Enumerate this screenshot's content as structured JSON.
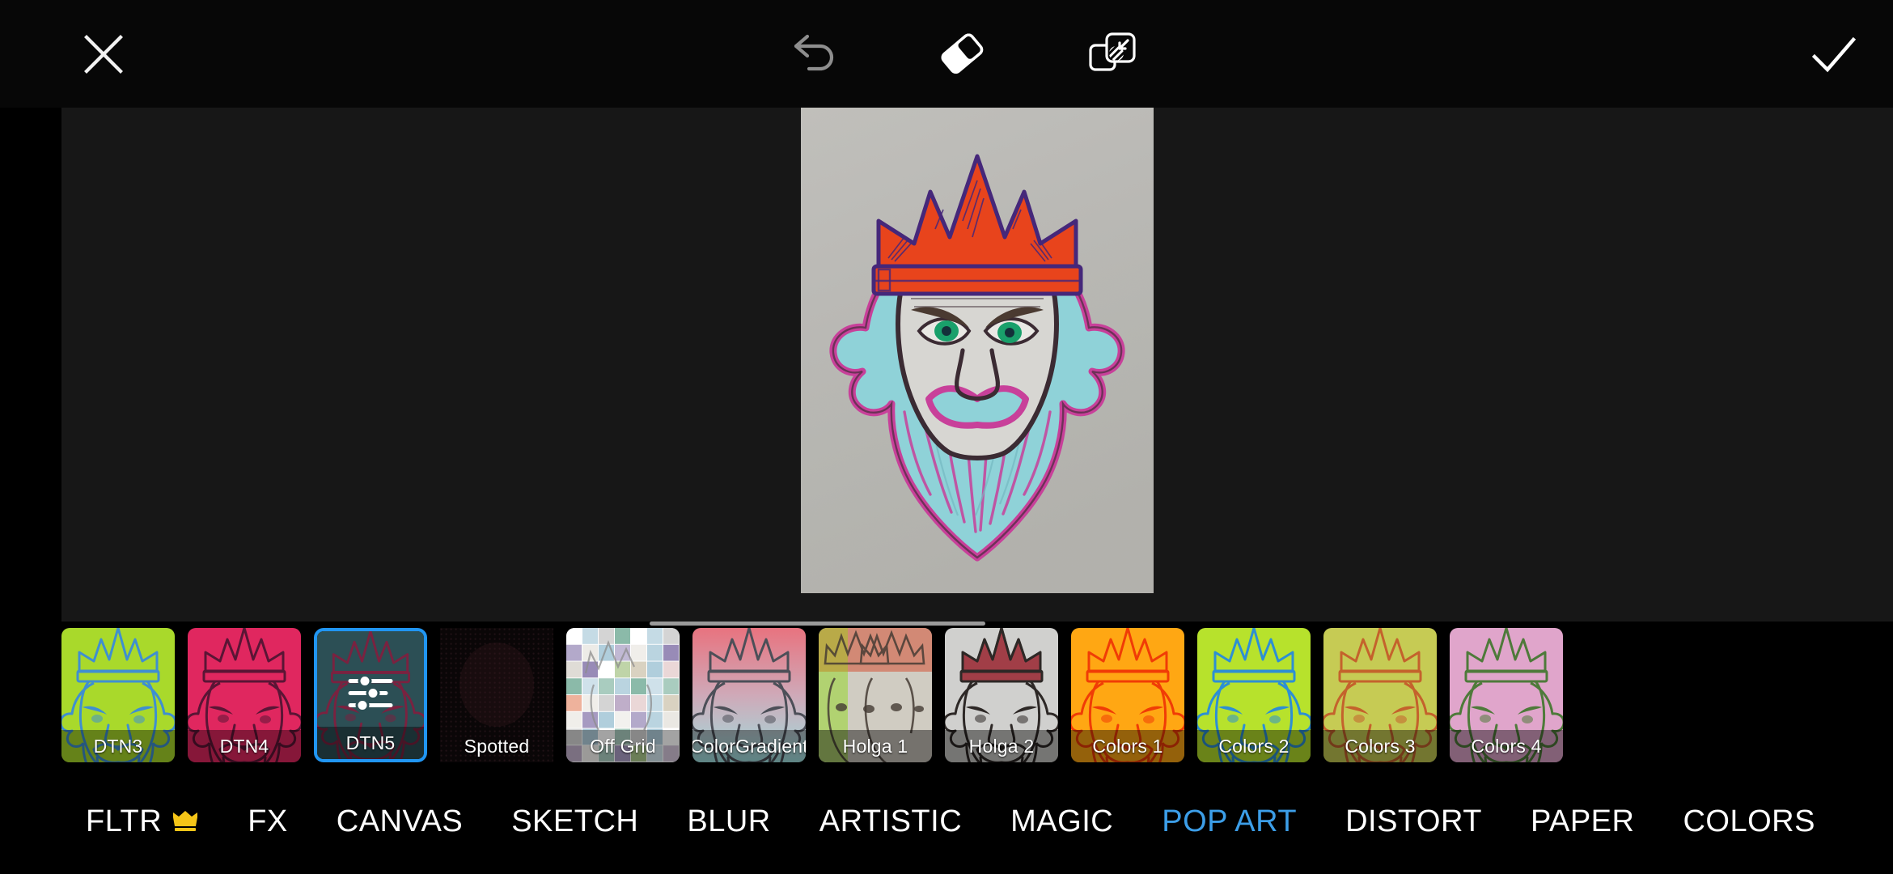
{
  "toolbar": {
    "close_label": "Close",
    "close_icon": "close-x-icon",
    "undo_label": "Undo",
    "undo_icon": "undo-arrow-icon",
    "eraser_label": "Eraser",
    "eraser_icon": "eraser-icon",
    "layers_label": "Compare",
    "layers_icon": "compare-layers-icon",
    "done_label": "Apply",
    "done_icon": "checkmark-icon"
  },
  "canvas": {
    "artwork_title": "King with crown drawing",
    "paper_color": "#bdbcb8",
    "crown_color": "#e8441c",
    "hair_color": "#8fd2d8",
    "hair_outline_color": "#c8409a",
    "ink_color": "#3b2b33",
    "eye_color": "#19a06b"
  },
  "filter_strip": {
    "selected": "DTN5",
    "selected_border_color": "#2196f3",
    "items": [
      {
        "label": "DTN3",
        "bg": "#a9d92b",
        "ink": "#3f8fd0",
        "band": "rgba(0,0,0,.40)",
        "style": "king",
        "icon": null
      },
      {
        "label": "DTN4",
        "bg": "#e0275f",
        "ink": "#5a1535",
        "band": "rgba(0,0,0,.40)",
        "style": "king",
        "icon": null
      },
      {
        "label": "DTN5",
        "bg": "#2c4f55",
        "ink": "#7a2240",
        "band": "rgba(0,0,0,.40)",
        "style": "king",
        "icon": "sliders-icon"
      },
      {
        "label": "Spotted",
        "bg": "#0a0607",
        "ink": "#241318",
        "band": "transparent",
        "style": "dots",
        "icon": null
      },
      {
        "label": "Off Grid",
        "bg": "#ffffff",
        "ink": "#8c8c8c",
        "band": "rgba(0,0,0,.36)",
        "style": "grid",
        "icon": null
      },
      {
        "label": "ColorGradient",
        "bg": "#e88a9a",
        "ink": "#4c4f58",
        "band": "rgba(0,0,0,.40)",
        "style": "gradient",
        "icon": null
      },
      {
        "label": "Holga 1",
        "bg": "#c9cfc0",
        "ink": "#4a4038",
        "band": "rgba(0,0,0,.44)",
        "style": "holga1",
        "icon": null
      },
      {
        "label": "Holga 2",
        "bg": "#d9d9d7",
        "ink": "#2f2a28",
        "band": "rgba(0,0,0,.44)",
        "style": "holga2",
        "icon": null
      },
      {
        "label": "Colors 1",
        "bg": "#ffa713",
        "ink": "#f03c06",
        "band": "rgba(0,0,0,.42)",
        "style": "king",
        "icon": null
      },
      {
        "label": "Colors 2",
        "bg": "#b7e22c",
        "ink": "#2d8fd4",
        "band": "rgba(0,0,0,.42)",
        "style": "king",
        "icon": null
      },
      {
        "label": "Colors 3",
        "bg": "#c6cb54",
        "ink": "#c4622c",
        "band": "rgba(0,0,0,.42)",
        "style": "king",
        "icon": null
      },
      {
        "label": "Colors 4",
        "bg": "#e0a5cb",
        "ink": "#4e7a3a",
        "band": "rgba(0,0,0,.42)",
        "style": "king",
        "icon": null
      }
    ]
  },
  "tabs": {
    "active": "POP ART",
    "items": [
      {
        "label": "FLTR",
        "premium": true
      },
      {
        "label": "FX",
        "premium": false
      },
      {
        "label": "CANVAS",
        "premium": false
      },
      {
        "label": "SKETCH",
        "premium": false
      },
      {
        "label": "BLUR",
        "premium": false
      },
      {
        "label": "ARTISTIC",
        "premium": false
      },
      {
        "label": "MAGIC",
        "premium": false
      },
      {
        "label": "POP ART",
        "premium": false
      },
      {
        "label": "DISTORT",
        "premium": false
      },
      {
        "label": "PAPER",
        "premium": false
      },
      {
        "label": "COLORS",
        "premium": false
      }
    ],
    "active_color": "#3c9ee8",
    "inactive_color": "#ffffff",
    "premium_badge_color": "#f5c518",
    "premium_badge_icon": "crown-icon"
  }
}
